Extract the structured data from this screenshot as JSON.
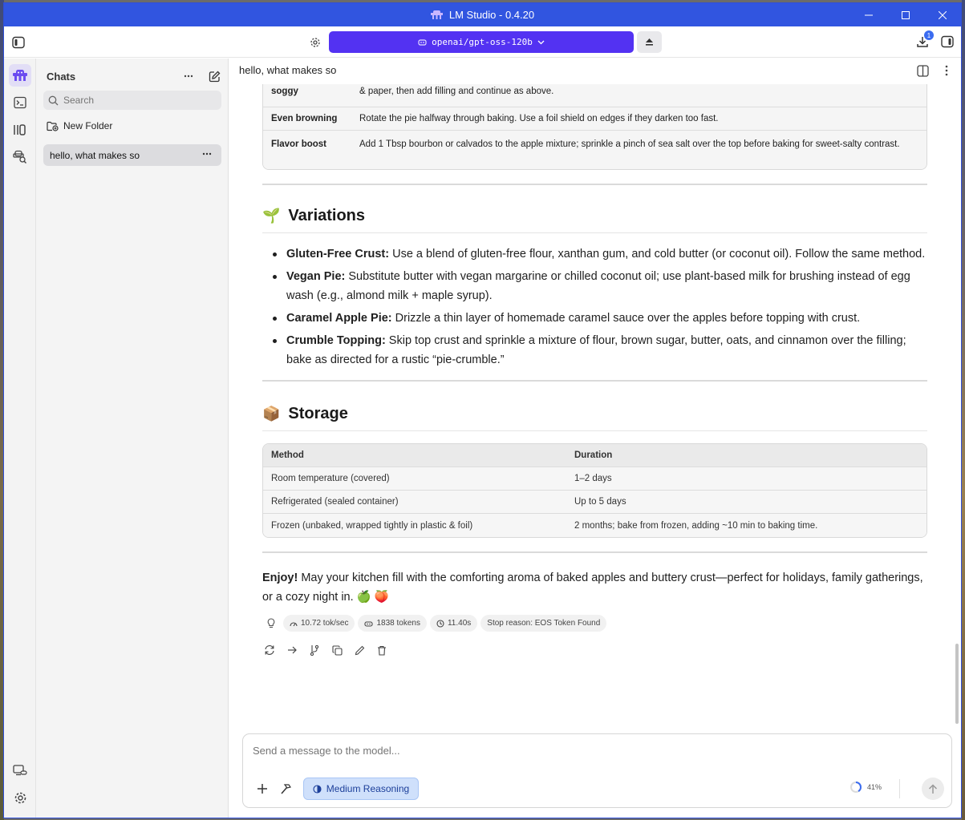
{
  "window": {
    "title": "LM Studio - 0.4.20"
  },
  "topbar": {
    "model_name": "openai/gpt-oss-120b",
    "download_badge": "1"
  },
  "sidebar": {
    "heading": "Chats",
    "search_placeholder": "Search",
    "new_folder_label": "New Folder",
    "chats": [
      {
        "title": "hello, what makes so"
      }
    ]
  },
  "main": {
    "chat_title": "hello, what makes so",
    "tips_table": {
      "rows": [
        {
          "key": "soggy",
          "value": "& paper, then add filling and continue as above."
        },
        {
          "key": "Even browning",
          "value": "Rotate the pie halfway through baking. Use a foil shield on edges if they darken too fast."
        },
        {
          "key": "Flavor boost",
          "value": "Add 1 Tbsp bourbon or calvados to the apple mixture; sprinkle a pinch of sea salt over the top before baking for sweet-salty contrast."
        }
      ]
    },
    "variations": {
      "emoji": "🌱",
      "heading": "Variations",
      "items": [
        {
          "title": "Gluten-Free Crust:",
          "text": " Use a blend of gluten-free flour, xanthan gum, and cold butter (or coconut oil). Follow the same method."
        },
        {
          "title": "Vegan Pie:",
          "text": " Substitute butter with vegan margarine or chilled coconut oil; use plant-based milk for brushing instead of egg wash (e.g., almond milk + maple syrup)."
        },
        {
          "title": "Caramel Apple Pie:",
          "text": " Drizzle a thin layer of homemade caramel sauce over the apples before topping with crust."
        },
        {
          "title": "Crumble Topping:",
          "text": " Skip top crust and sprinkle a mixture of flour, brown sugar, butter, oats, and cinnamon over the filling; bake as directed for a rustic “pie-crumble.”"
        }
      ]
    },
    "storage": {
      "emoji": "📦",
      "heading": "Storage",
      "headers": [
        "Method",
        "Duration"
      ],
      "rows": [
        [
          "Room temperature (covered)",
          "1–2 days"
        ],
        [
          "Refrigerated (sealed container)",
          "Up to 5 days"
        ],
        [
          "Frozen (unbaked, wrapped tightly in plastic & foil)",
          "2 months; bake from frozen, adding ~10 min to baking time."
        ]
      ]
    },
    "closing": {
      "bold": "Enjoy!",
      "text": " May your kitchen fill with the comforting aroma of baked apples and buttery crust—perfect for holidays, family gatherings, or a cozy night in.",
      "emojis": "🍏 🍑"
    },
    "stats": {
      "speed": "10.72 tok/sec",
      "tokens": "1838 tokens",
      "time": "11.40s",
      "stop_reason": "Stop reason: EOS Token Found"
    }
  },
  "composer": {
    "placeholder": "Send a message to the model...",
    "reasoning_label": "Medium Reasoning",
    "context_usage": "41%"
  }
}
